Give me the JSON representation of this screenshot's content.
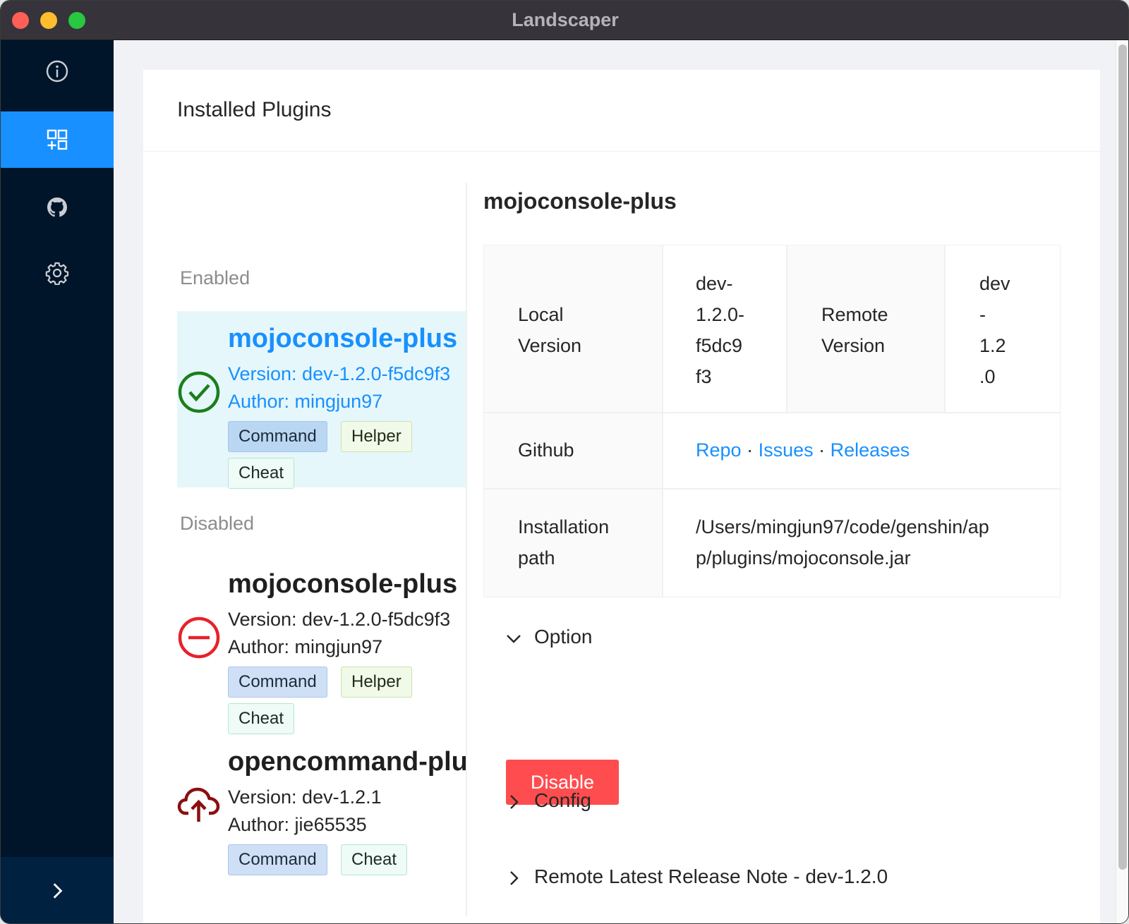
{
  "window": {
    "title": "Landscaper"
  },
  "sidebar": {
    "items": [
      {
        "icon": "info-icon",
        "active": false
      },
      {
        "icon": "plugins-icon",
        "active": true
      },
      {
        "icon": "github-icon",
        "active": false
      },
      {
        "icon": "gear-icon",
        "active": false
      }
    ],
    "collapse_icon": "chevron-right-icon"
  },
  "card": {
    "title": "Installed Plugins"
  },
  "list": {
    "enabled_label": "Enabled",
    "disabled_label": "Disabled",
    "enabled": [
      {
        "name": "mojoconsole-plus",
        "version": "Version: dev-1.2.0-f5dc9f3",
        "author": "Author: mingjun97",
        "tags": [
          "Command",
          "Helper",
          "Cheat"
        ],
        "status_icon": "check-circle-icon",
        "status_color": "#1a7f1a"
      }
    ],
    "disabled": [
      {
        "name": "mojoconsole-plus",
        "version": "Version: dev-1.2.0-f5dc9f3",
        "author": "Author: mingjun97",
        "tags": [
          "Command",
          "Helper",
          "Cheat"
        ],
        "status_icon": "minus-circle-icon",
        "status_color": "#e8202a"
      },
      {
        "name": "opencommand-plus",
        "version": "Version: dev-1.2.1",
        "author": "Author: jie65535",
        "tags": [
          "Command",
          "Cheat"
        ],
        "status_icon": "cloud-upload-icon",
        "status_color": "#8b0f0f"
      }
    ]
  },
  "detail": {
    "title": "mojoconsole-plus",
    "local_version_label_1": "Local",
    "local_version_label_2": "Version",
    "local_version_lines": [
      "dev-",
      "1.2.0-",
      "f5dc9",
      "f3"
    ],
    "remote_version_label_1": "Remote",
    "remote_version_label_2": "Version",
    "remote_version_lines": [
      "dev",
      "-",
      "1.2",
      ".0"
    ],
    "github_label": "Github",
    "links": {
      "repo": "Repo",
      "issues": "Issues",
      "releases": "Releases",
      "sep": "·"
    },
    "path_label_1": "Installation",
    "path_label_2": "path",
    "path_line_1": "/Users/mingjun97/code/genshin/ap",
    "path_line_2": "p/plugins/mojoconsole.jar",
    "option_label": "Option",
    "disable_label": "Disable",
    "config_label": "Config",
    "release_note_label": "Remote Latest Release Note - dev-1.2.0"
  },
  "colors": {
    "accent": "#1890ff",
    "sidebar": "#001529",
    "danger": "#ff4d4f"
  }
}
